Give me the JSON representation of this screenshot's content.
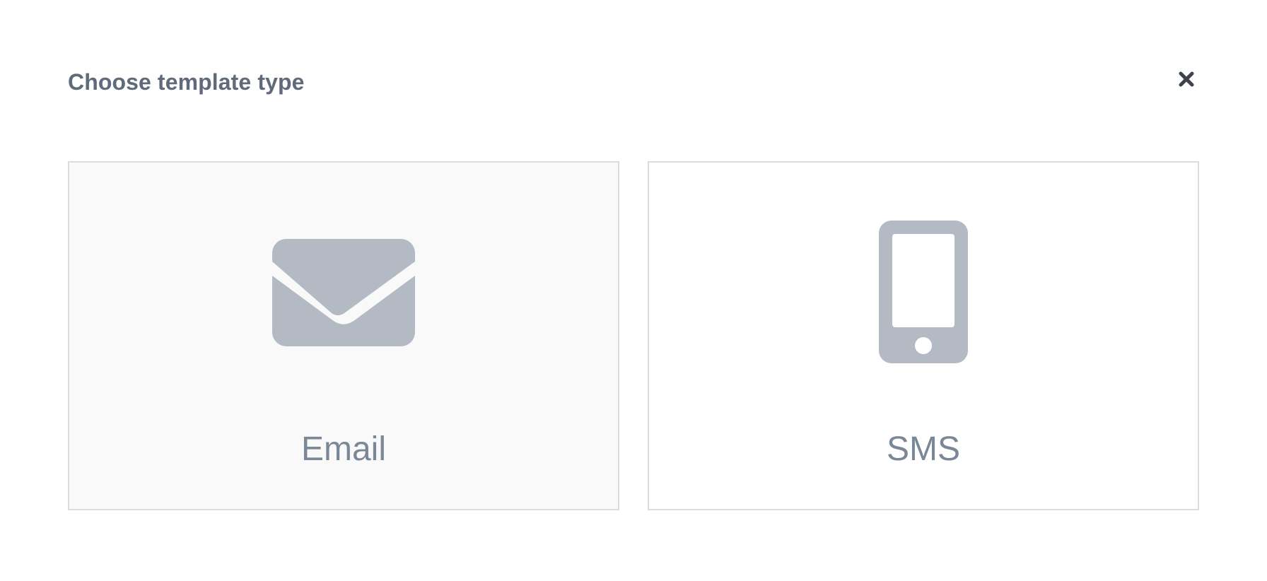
{
  "dialog": {
    "title": "Choose template type",
    "close_icon": "close-icon"
  },
  "options": [
    {
      "label": "Email",
      "icon": "envelope-icon",
      "state": "hovered"
    },
    {
      "label": "SMS",
      "icon": "mobile-phone-icon",
      "state": "default"
    }
  ],
  "colors": {
    "title": "#5f6b7a",
    "icon": "#b3bac3",
    "label": "#7a8797",
    "card_border": "#dcdcdc",
    "hover_background": "#f9f9f9"
  }
}
